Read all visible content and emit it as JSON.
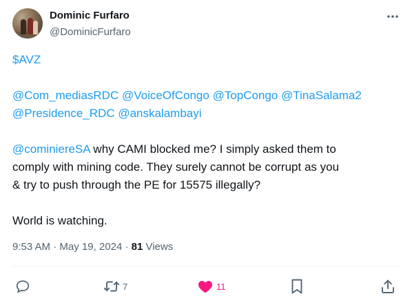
{
  "author": {
    "name": "Dominic Furfaro",
    "handle": "@DominicFurfaro"
  },
  "tweet": {
    "cashtag": "$AVZ",
    "mentions_line1": "@Com_mediasRDC @VoiceOfCongo @TopCongo @TinaSalama2",
    "mentions_line2": "@Presidence_RDC @anskalambayi",
    "reply_mention": "@cominiereSA",
    "body_line1": " why CAMI blocked me? I simply asked them to",
    "body_line2": "comply with mining code. They surely cannot be corrupt as you",
    "body_line3": "& try to push through the PE for 15575 illegally?",
    "closing": "World is watching."
  },
  "meta": {
    "time": "9:53 AM",
    "separator1": " · ",
    "date": "May 19, 2024",
    "separator2": " · ",
    "views_count": "81",
    "views_label": " Views"
  },
  "actions": {
    "reply_count": "",
    "retweet_count": "7",
    "like_count": "11"
  },
  "colors": {
    "link": "#1d9bf0",
    "like": "#f91880",
    "muted": "#536471"
  },
  "icons": [
    "more-icon",
    "reply-icon",
    "retweet-icon",
    "like-icon",
    "bookmark-icon",
    "share-icon"
  ]
}
